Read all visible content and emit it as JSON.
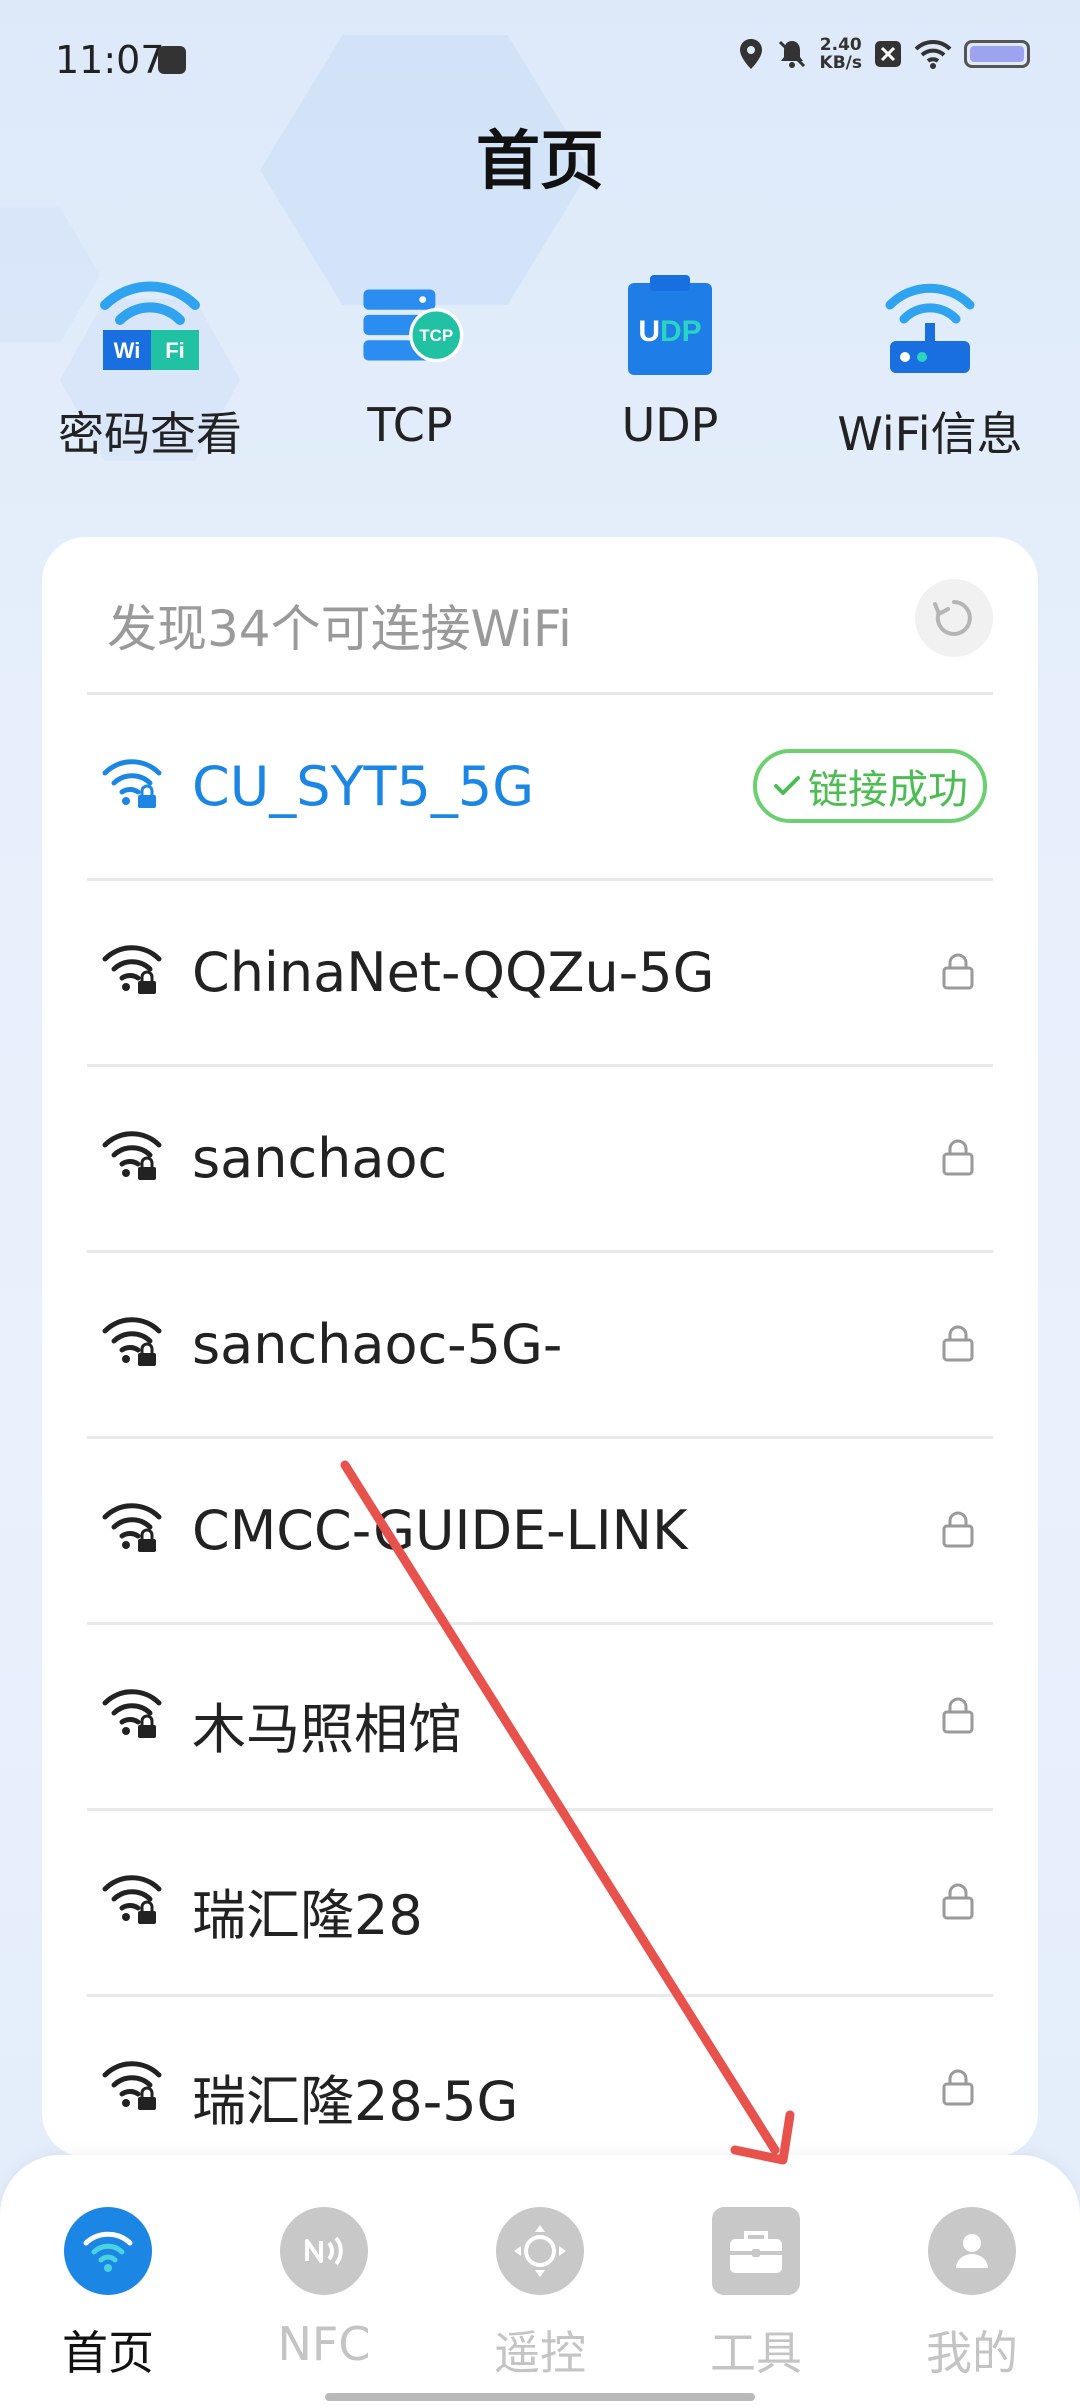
{
  "status_bar": {
    "time": "11:07",
    "speed_value": "2.40",
    "speed_unit": "KB/s"
  },
  "page": {
    "title": "首页"
  },
  "quick_tools": [
    {
      "label": "密码查看",
      "icon": "wifi-password-icon"
    },
    {
      "label": "TCP",
      "icon": "tcp-server-icon"
    },
    {
      "label": "UDP",
      "icon": "udp-clipboard-icon"
    },
    {
      "label": "WiFi信息",
      "icon": "router-icon"
    }
  ],
  "wifi_list": {
    "summary": "发现34个可连接WiFi",
    "connected_badge": "链接成功",
    "networks": [
      {
        "ssid": "CU_SYT5_5G",
        "connected": true
      },
      {
        "ssid": "ChinaNet-QQZu-5G",
        "connected": false
      },
      {
        "ssid": "sanchaoc",
        "connected": false
      },
      {
        "ssid": "sanchaoc-5G-",
        "connected": false
      },
      {
        "ssid": "CMCC-GUIDE-LINK",
        "connected": false
      },
      {
        "ssid": "木马照相馆",
        "connected": false
      },
      {
        "ssid": "瑞汇隆28",
        "connected": false
      },
      {
        "ssid": "瑞汇隆28-5G",
        "connected": false
      }
    ]
  },
  "bottom_nav": [
    {
      "label": "首页",
      "active": true
    },
    {
      "label": "NFC",
      "active": false
    },
    {
      "label": "遥控",
      "active": false
    },
    {
      "label": "工具",
      "active": false
    },
    {
      "label": "我的",
      "active": false
    }
  ],
  "colors": {
    "accent": "#1c86e4",
    "success": "#4cbd52",
    "annotation_arrow": "#e8524d"
  }
}
